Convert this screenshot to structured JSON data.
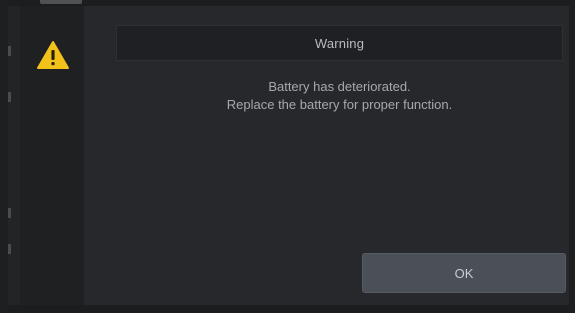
{
  "dialog": {
    "title": "Warning",
    "message_line_1": "Battery has deteriorated.",
    "message_line_2": "Replace the battery for proper function.",
    "ok_label": "OK",
    "icon": "warning-triangle-icon"
  },
  "colors": {
    "warning_icon": "#f2c21a",
    "background": "#232427",
    "button": "#4b5058"
  }
}
